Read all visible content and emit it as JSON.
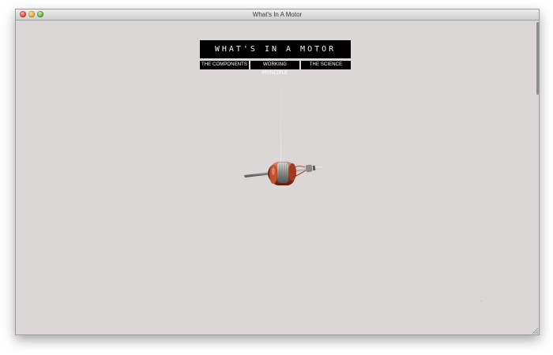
{
  "window": {
    "title": "What's In A Motor"
  },
  "site": {
    "logo_text": "WHAT'S IN A MOTOR",
    "nav": [
      {
        "label": "THE COMPONENTS"
      },
      {
        "label": "WORKING PRINCIPLE"
      },
      {
        "label": "THE SCIENCE"
      }
    ]
  },
  "hero": {
    "image": "motor-armature-rotor"
  },
  "colors": {
    "page_background": "#dcd7d7",
    "nav_background": "#000000",
    "nav_text": "#ffffff",
    "copper": "#b5432a"
  },
  "icons": {
    "close": "close-icon",
    "minimize": "minimize-icon",
    "maximize": "maximize-icon",
    "resize": "resize-grip-icon"
  }
}
